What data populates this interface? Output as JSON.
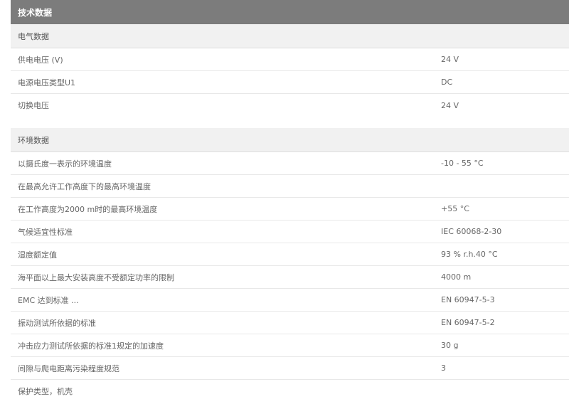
{
  "header": {
    "title": "技术数据"
  },
  "electrical": {
    "title": "电气数据",
    "rows": [
      {
        "label": "供电电压 (V)",
        "value": "24  V"
      },
      {
        "label": "电源电压类型U1",
        "value": "DC"
      },
      {
        "label": "切换电压",
        "value": "24  V"
      }
    ]
  },
  "environment": {
    "title": "环境数据",
    "rows": [
      {
        "label": "以摄氏度一表示的环境温度",
        "value": "-10 - 55  °C"
      },
      {
        "label": "在最高允许工作高度下的最高环境温度",
        "value": ""
      },
      {
        "label": "在工作高度为2000 m时的最高环境温度",
        "value": "+55 °C"
      },
      {
        "label": "气候适宜性标准",
        "value": "IEC 60068-2-30"
      },
      {
        "label": "湿度额定值",
        "value": "93 % r.h.40 °C"
      },
      {
        "label": "海平面以上最大安装高度不受额定功率的限制",
        "value": "4000 m"
      },
      {
        "label": "EMC 达到标准 ...",
        "value": "EN 60947-5-3"
      },
      {
        "label": "振动测试所依据的标准",
        "value": "EN 60947-5-2"
      },
      {
        "label": "冲击应力测试所依据的标准1规定的加速度",
        "value": "30 g"
      },
      {
        "label": "间隙与爬电距离污染程度规范",
        "value": "3"
      },
      {
        "label": "保护类型，机壳",
        "value": ""
      }
    ]
  }
}
